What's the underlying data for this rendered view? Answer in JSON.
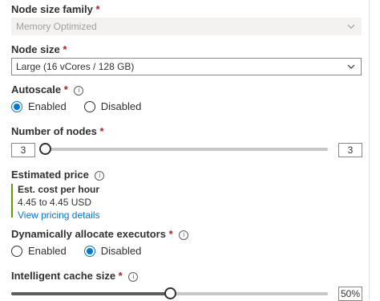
{
  "node_size_family": {
    "label": "Node size family",
    "required_mark": "*",
    "value": "Memory Optimized",
    "disabled": true
  },
  "node_size": {
    "label": "Node size",
    "required_mark": "*",
    "value": "Large (16 vCores / 128 GB)"
  },
  "autoscale": {
    "label": "Autoscale",
    "required_mark": "*",
    "info_icon": "info-icon",
    "options": [
      "Enabled",
      "Disabled"
    ],
    "selected": "Enabled"
  },
  "number_of_nodes": {
    "label": "Number of nodes",
    "required_mark": "*",
    "min_value": "3",
    "max_value": "3",
    "slider_fraction": 0.0
  },
  "estimated_price": {
    "label": "Estimated price",
    "info_icon": "info-icon",
    "title": "Est. cost per hour",
    "range": "4.45 to 4.45 USD",
    "link": "View pricing details",
    "accent_color": "#57a300"
  },
  "dynamic_executors": {
    "label": "Dynamically allocate executors",
    "required_mark": "*",
    "info_icon": "info-icon",
    "options": [
      "Enabled",
      "Disabled"
    ],
    "selected": "Disabled"
  },
  "intelligent_cache": {
    "label": "Intelligent cache size",
    "required_mark": "*",
    "info_icon": "info-icon",
    "value": "50%",
    "slider_fraction": 0.5
  },
  "colors": {
    "accent": "#0078d4",
    "required": "#a4262c",
    "text": "#323130"
  }
}
